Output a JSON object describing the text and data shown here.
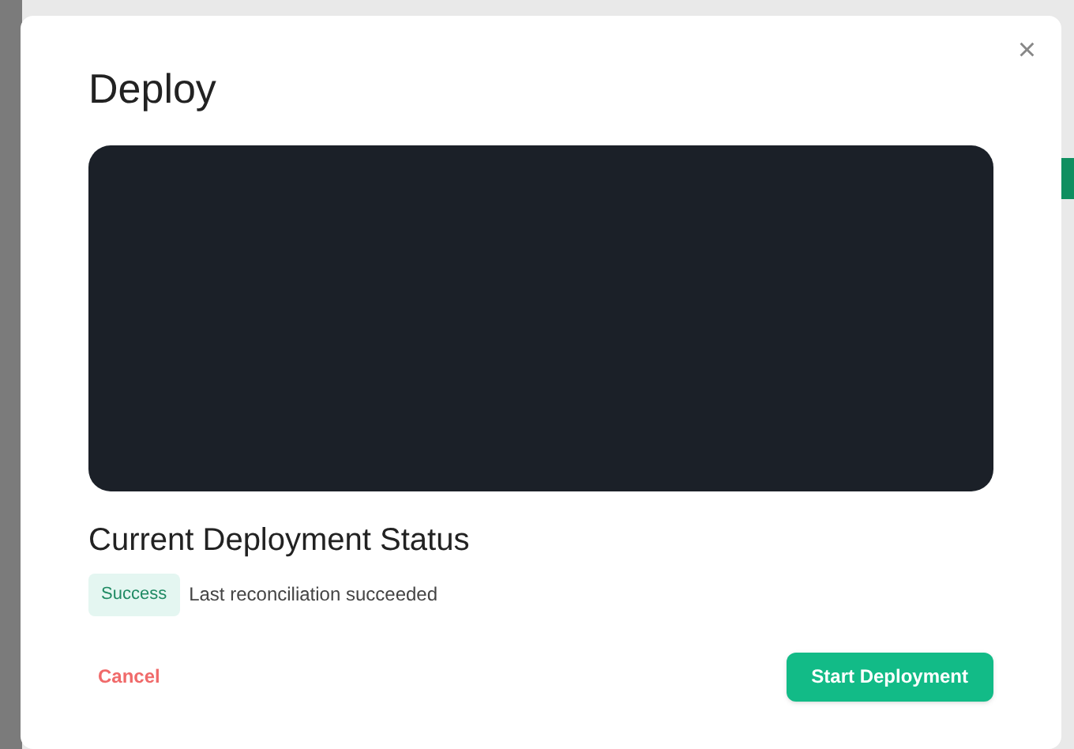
{
  "dialog": {
    "title": "Deploy",
    "close": "×",
    "status_heading": "Current Deployment Status",
    "status_badge": "Success",
    "status_message": "Last reconciliation succeeded",
    "cancel": "Cancel",
    "primary": "Start Deployment"
  }
}
